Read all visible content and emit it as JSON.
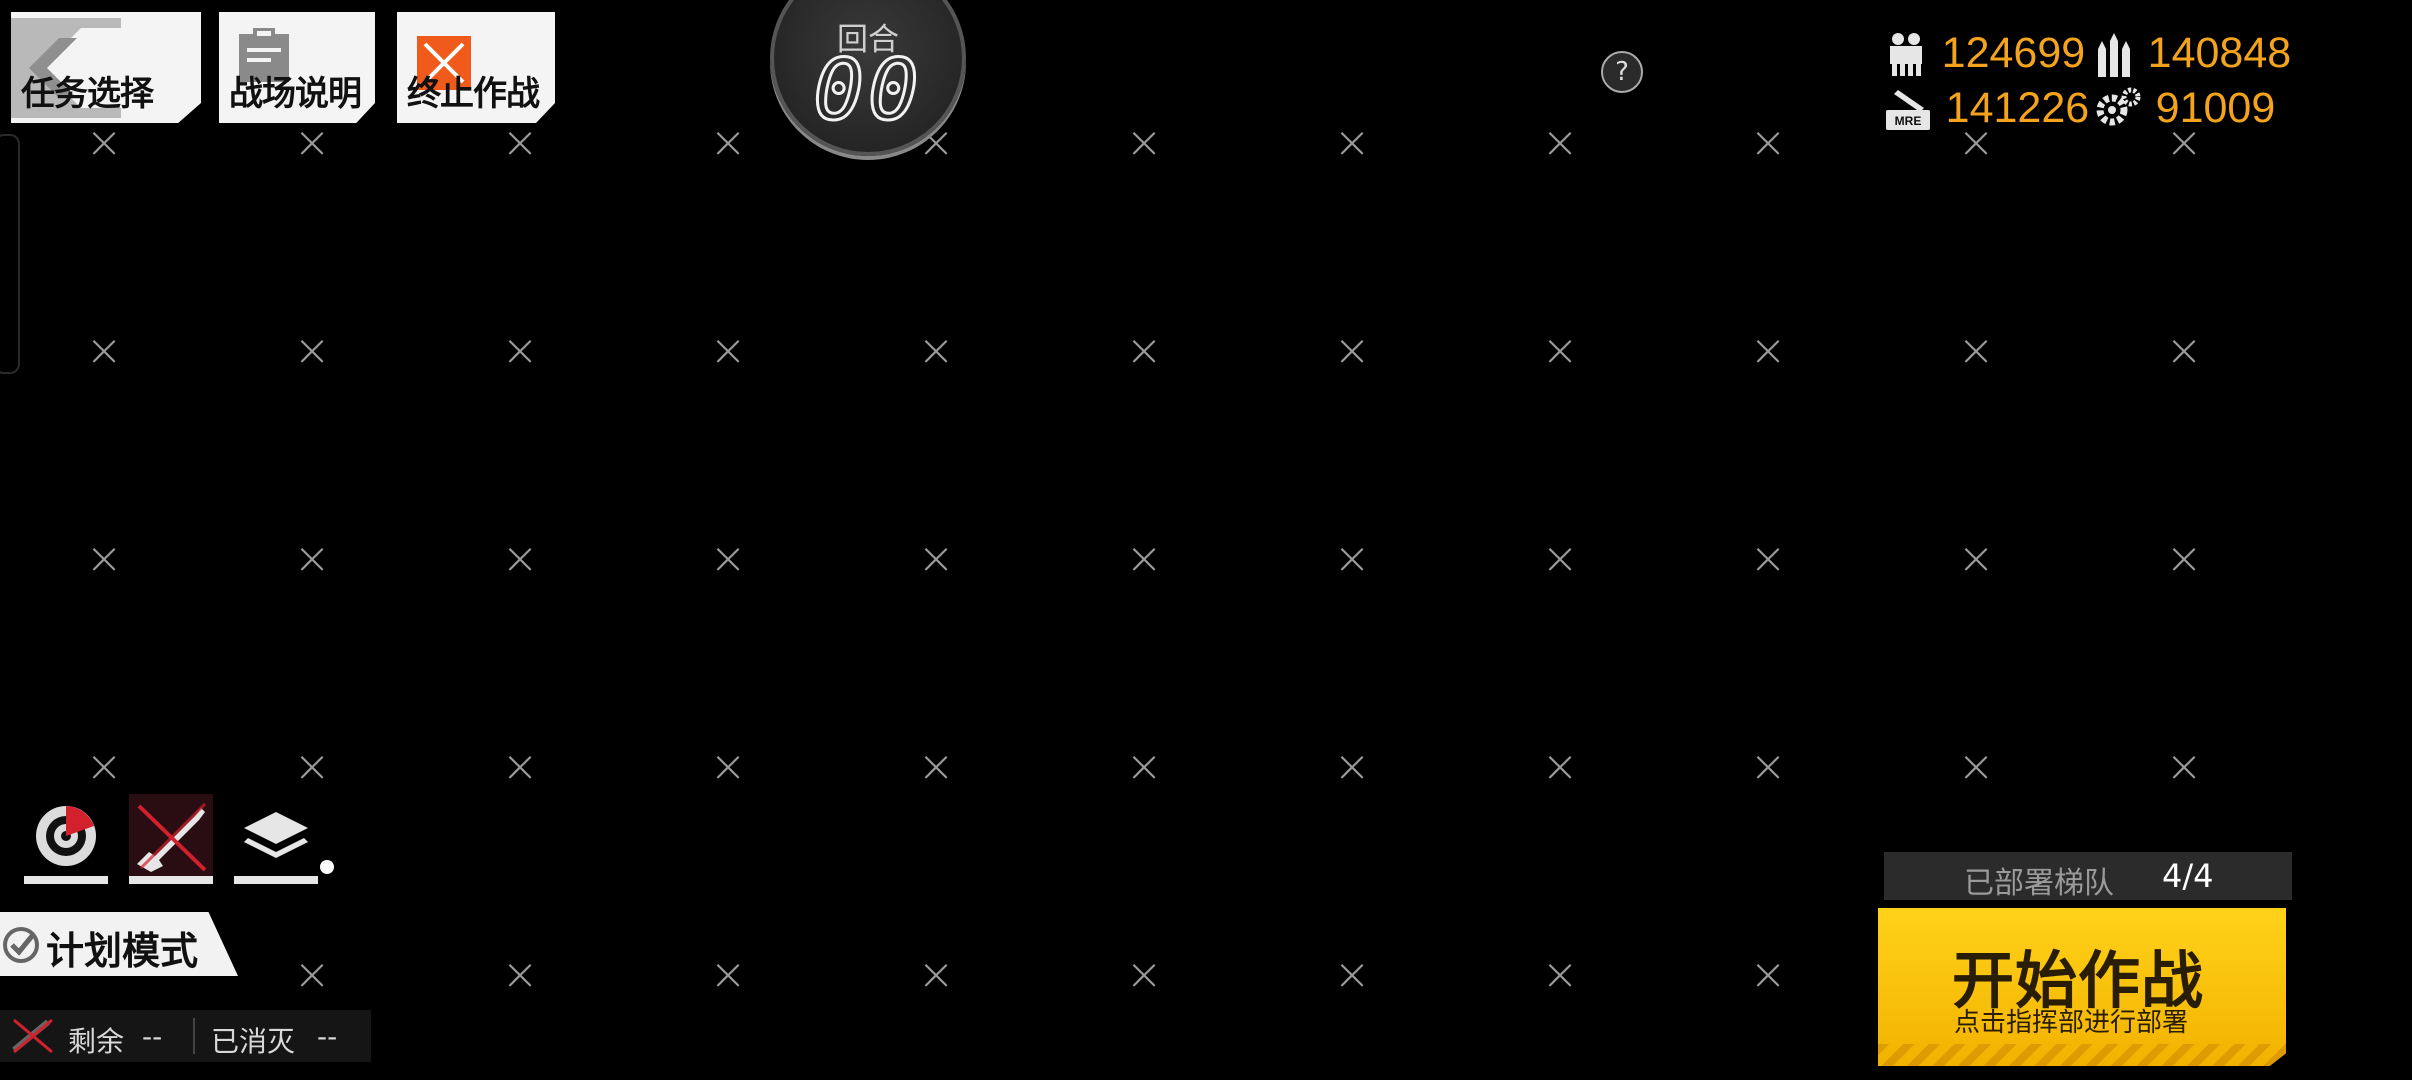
{
  "menu": {
    "mission_select": "任务选择",
    "battlefield_info": "战场说明",
    "abort_battle": "终止作战"
  },
  "turn": {
    "label": "回合",
    "value": "00"
  },
  "help": {
    "label": "?"
  },
  "resources": {
    "manpower": "124699",
    "ammo": "140848",
    "rations": "141226",
    "parts": "91009",
    "ration_icon_text": "MRE"
  },
  "grid_mark": "×",
  "plan_mode": {
    "label": "计划模式"
  },
  "enemy_status": {
    "remain_label": "剩余",
    "remain_value": "--",
    "killed_label": "已消灭",
    "killed_value": "--"
  },
  "deploy": {
    "label": "已部署梯队",
    "value": "4/4"
  },
  "start": {
    "title": "开始作战",
    "subtitle": "点击指挥部进行部署"
  },
  "colors": {
    "resource": "#f4a31c",
    "start_button": "#ffd21a",
    "abort_accent": "#f05a1a",
    "rifle_accent": "#d2202d"
  }
}
